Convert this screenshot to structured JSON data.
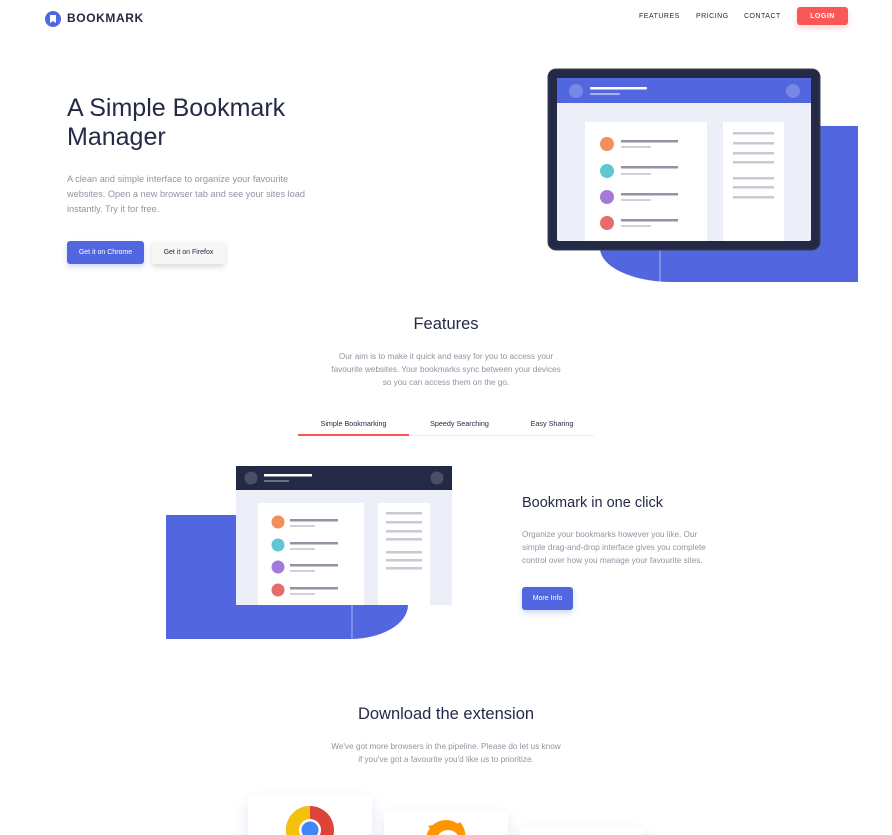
{
  "brand": {
    "name": "BOOKMARK",
    "accent": "#5267df",
    "red": "#fa5757",
    "navy": "#242a45"
  },
  "nav": {
    "features": "FEATURES",
    "pricing": "PRICING",
    "contact": "CONTACT",
    "login": "LOGIN"
  },
  "hero": {
    "title_line1": "A Simple Bookmark",
    "title_line2": "Manager",
    "desc_line1": "A clean and simple interface to organize your favourite",
    "desc_line2": "websites. Open a new browser tab and see your sites load",
    "desc_line3": "instantly. Try it for free.",
    "chrome_button": "Get it on Chrome",
    "firefox_button": "Get it on Firefox"
  },
  "features": {
    "title": "Features",
    "desc_line1": "Our aim is to make it quick and easy for you to access your",
    "desc_line2": "favourite websites. Your bookmarks sync between your devices",
    "desc_line3": "so you can access them on the go.",
    "tabs": [
      {
        "label": "Simple Bookmarking",
        "active": true
      },
      {
        "label": "Speedy Searching",
        "active": false
      },
      {
        "label": "Easy Sharing",
        "active": false
      }
    ],
    "panel": {
      "title": "Bookmark in one click",
      "desc_line1": "Organize your bookmarks however you like. Our",
      "desc_line2": "simple drag-and-drop interface gives you complete",
      "desc_line3": "control over how you manage your favourite sites.",
      "button": "More Info"
    }
  },
  "download": {
    "title": "Download the extension",
    "desc_line1": "We've got more browsers in the pipeline. Please do let us know",
    "desc_line2": "if you've got a favourite you'd like us to prioritize."
  },
  "icons": {
    "logo": "bookmark-logo-icon",
    "chrome": "chrome-logo-icon",
    "firefox": "firefox-logo-icon"
  },
  "illustration_dot_colors": [
    "#f28f5c",
    "#5fc7cf",
    "#a37ad9",
    "#e86c6c"
  ]
}
